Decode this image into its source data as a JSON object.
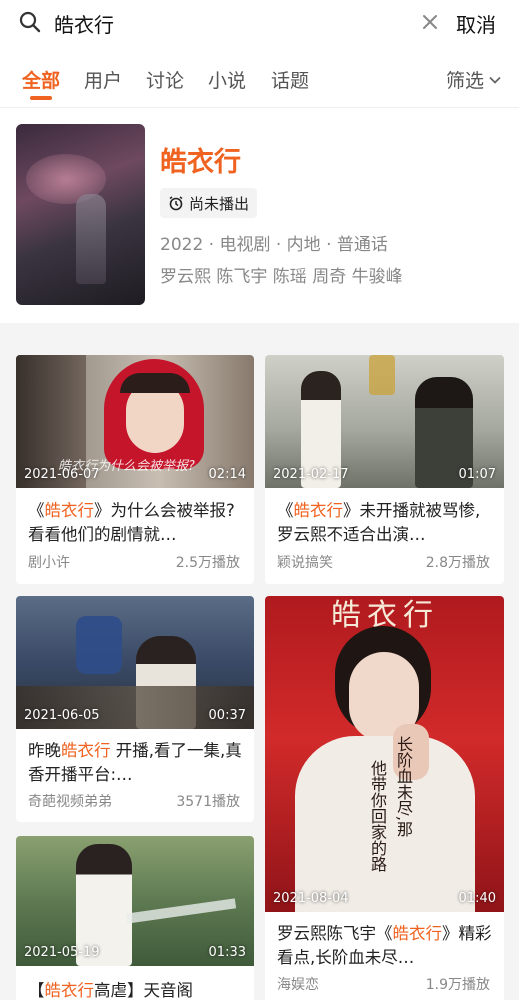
{
  "search": {
    "query": "皓衣行",
    "cancel_label": "取消"
  },
  "tabs": [
    {
      "label": "全部",
      "active": true
    },
    {
      "label": "用户",
      "active": false
    },
    {
      "label": "讨论",
      "active": false
    },
    {
      "label": "小说",
      "active": false
    },
    {
      "label": "话题",
      "active": false
    }
  ],
  "filter_label": "筛选",
  "show": {
    "title": "皓衣行",
    "status": "尚未播出",
    "meta": "2022 · 电视剧 · 内地 · 普通话",
    "cast": "罗云熙 陈飞宇 陈瑶 周奇 牛骏峰"
  },
  "videos": [
    {
      "date": "2021-06-07",
      "duration": "02:14",
      "caption": "皓衣行为什么会被举报?",
      "title_pre": "《",
      "title_hl": "皓衣行",
      "title_post": "》为什么会被举报?看看他们的剧情就…",
      "author": "剧小许",
      "plays": "2.5万播放"
    },
    {
      "date": "2021-02-17",
      "duration": "01:07",
      "caption": "",
      "title_pre": "《",
      "title_hl": "皓衣行",
      "title_post": "》未开播就被骂惨,罗云熙不适合出演…",
      "author": "颖说搞笑",
      "plays": "2.8万播放"
    },
    {
      "date": "2021-06-05",
      "duration": "00:37",
      "caption": "",
      "title_pre": "昨晚",
      "title_hl": "皓衣行",
      "title_post": " 开播,看了一集,真香开播平台:…",
      "author": "奇葩视频弟弟",
      "plays": "3571播放"
    },
    {
      "date": "2021-08-04",
      "duration": "01:40",
      "caption": "",
      "poster_top": "皓衣行",
      "poster_col1": "长阶血未尽,那",
      "poster_col2": "他带你回家的路",
      "title_pre": "罗云熙陈飞宇《",
      "title_hl": "皓衣行",
      "title_post": "》精彩看点,长阶血未尽…",
      "author": "海娱恋",
      "plays": "1.9万播放"
    },
    {
      "date": "2021-05-19",
      "duration": "01:33",
      "caption": "",
      "title_pre": "【",
      "title_hl": "皓衣行",
      "title_post": "高虐】天音阁",
      "author": "",
      "plays": ""
    }
  ]
}
